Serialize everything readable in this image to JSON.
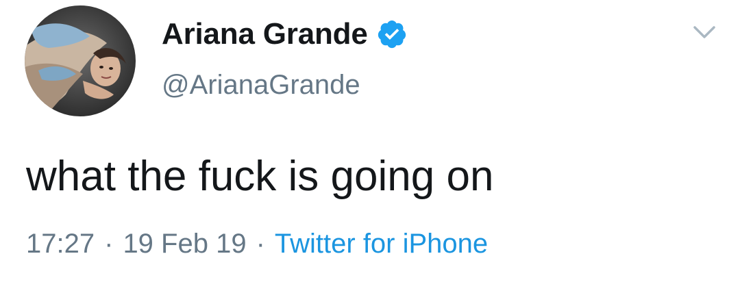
{
  "tweet": {
    "author": {
      "display_name": "Ariana Grande",
      "handle": "@ArianaGrande",
      "verified": true,
      "verified_icon": "verified-badge-icon",
      "verified_color": "#1da1f2",
      "avatar": "profile-photo"
    },
    "menu_icon": "chevron-down-icon",
    "text": "what the fuck is going on",
    "time": "17:27",
    "separator": "·",
    "date": "19 Feb 19",
    "source": "Twitter for iPhone",
    "source_color": "#1b95e0"
  }
}
